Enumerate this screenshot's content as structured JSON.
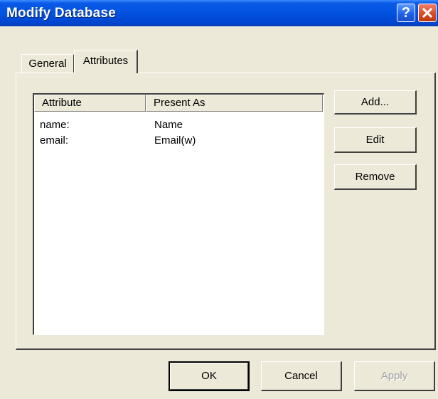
{
  "window": {
    "title": "Modify Database"
  },
  "titlebar_buttons": {
    "help": "?",
    "close_icon": "close-icon"
  },
  "tabs": [
    {
      "label": "General",
      "selected": false
    },
    {
      "label": "Attributes",
      "selected": true
    }
  ],
  "attributes_list": {
    "columns": [
      "Attribute",
      "Present As"
    ],
    "rows": [
      {
        "attribute": "name:",
        "present_as": "Name"
      },
      {
        "attribute": "email:",
        "present_as": "Email(w)"
      }
    ]
  },
  "side_buttons": {
    "add": "Add...",
    "edit": "Edit",
    "remove": "Remove"
  },
  "footer": {
    "ok": "OK",
    "cancel": "Cancel",
    "apply": "Apply",
    "apply_enabled": false
  },
  "colors": {
    "titlebar": "#0352e0",
    "face": "#ece9d8",
    "close": "#d9481e"
  }
}
